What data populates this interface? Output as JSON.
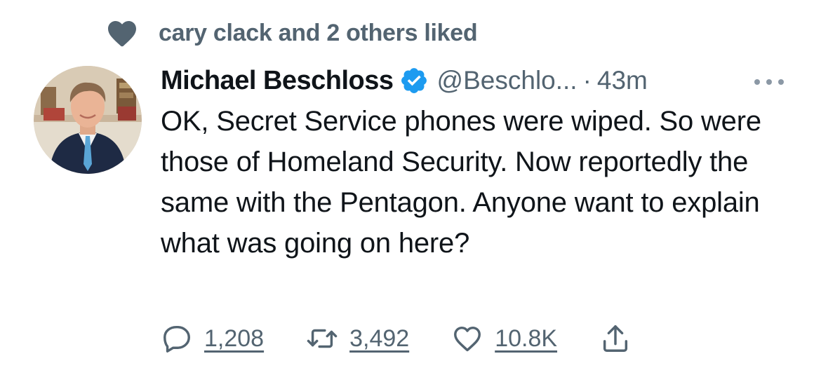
{
  "social_context": {
    "text": "cary clack and 2 others liked"
  },
  "tweet": {
    "author_name": "Michael Beschloss",
    "handle": "@Beschlo...",
    "separator": "·",
    "time": "43m",
    "text": "OK, Secret Service phones were wiped.  So were those of Homeland Security.  Now reportedly the same with the Pentagon.  Anyone want to explain what was going on here?"
  },
  "actions": {
    "reply_count": "1,208",
    "retweet_count": "3,492",
    "like_count": "10.8K"
  },
  "icons": {
    "social_like": "heart-icon",
    "verified": "verified-badge-icon",
    "more": "more-options-icon",
    "reply": "reply-icon",
    "retweet": "retweet-icon",
    "like": "like-heart-icon",
    "share": "share-icon"
  },
  "colors": {
    "text_primary": "#0f1419",
    "text_secondary": "#536471",
    "verified": "#1d9bf0",
    "social_heart": "#536471"
  }
}
